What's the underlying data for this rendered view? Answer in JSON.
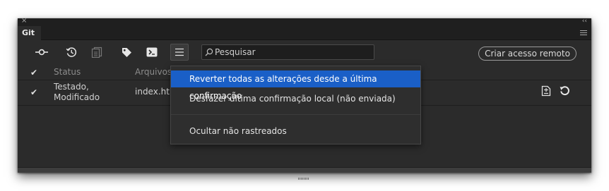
{
  "window": {
    "close_glyph": "×",
    "collapse_glyph": "‹‹"
  },
  "tab": {
    "label": "Git"
  },
  "toolbar": {
    "search_placeholder": "Pesquisar",
    "remote_button_label": "Criar acesso remoto",
    "icons": [
      "commit-icon",
      "history-icon",
      "stash-icon",
      "tag-icon",
      "terminal-icon",
      "menu-icon"
    ]
  },
  "table": {
    "columns": {
      "status": "Status",
      "files": "Arquivos"
    },
    "rows": [
      {
        "checked": true,
        "status_line1": "Testado,",
        "status_line2": "Modificado",
        "file": "index.htm"
      }
    ]
  },
  "dropdown": {
    "items": [
      {
        "label": "Reverter todas as alterações desde a última confirmação",
        "highlighted": true
      },
      {
        "label": "Desfazer última confirmação local (não enviada)",
        "highlighted": false
      },
      {
        "label": "Ocultar não rastreados",
        "highlighted": false
      }
    ]
  },
  "colors": {
    "panel_bg": "#2b2b2b",
    "highlight": "#1a5fc7",
    "text": "#d0d0d0"
  }
}
